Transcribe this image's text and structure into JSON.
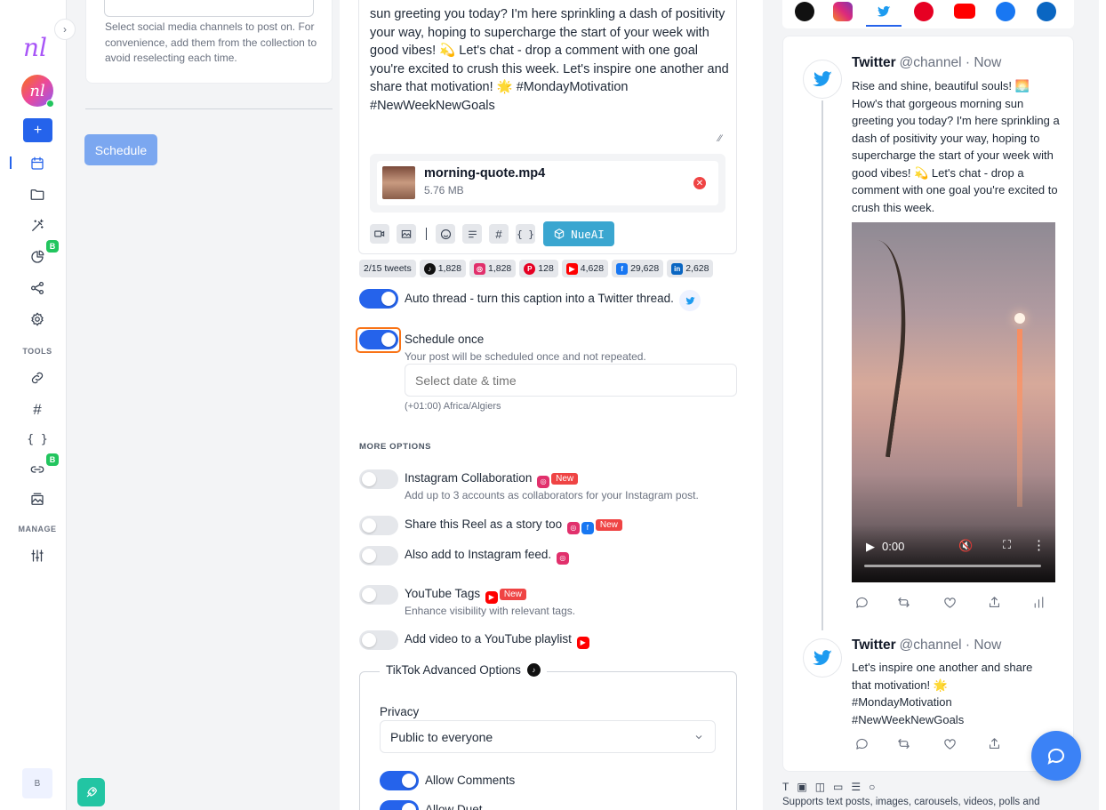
{
  "sidebar": {
    "logo_text": "nl",
    "avatar_text": "nl",
    "add_label": "+",
    "tools_label": "TOOLS",
    "manage_label": "MANAGE",
    "badge_b": "B",
    "bottom_user_initial": "B"
  },
  "left": {
    "channels_hint": "Select social media channels to post on. For convenience, add them from the collection to avoid reselecting each time.",
    "schedule_button": "Schedule"
  },
  "caption": {
    "lines": [
      "sun greeting you today? I'm here sprinkling a dash of positivity",
      "your way, hoping to supercharge the start of your week with",
      "good vibes! 💫 Let's chat - drop a comment with one goal",
      "you're excited to crush this week. Let's inspire one another and",
      "share that motivation! 🌟 #MondayMotivation",
      "#NewWeekNewGoals"
    ]
  },
  "media": {
    "file_name": "morning-quote.mp4",
    "file_size": "5.76 MB"
  },
  "toolbar": {
    "curly_label": "{ }",
    "hash_label": "#",
    "nueai_label": "NueAI"
  },
  "counts": {
    "tweets": "2/15 tweets",
    "tiktok": "1,828",
    "instagram": "1,828",
    "pinterest": "128",
    "youtube": "4,628",
    "facebook": "29,628",
    "linkedin": "2,628"
  },
  "auto_thread_label": "Auto thread - turn this caption into a Twitter thread.",
  "schedule_once": {
    "title": "Schedule once",
    "subtitle": "Your post will be scheduled once and not repeated.",
    "date_placeholder": "Select date & time",
    "timezone": "(+01:00) Africa/Algiers"
  },
  "more_options": {
    "heading": "MORE OPTIONS",
    "ig_collab_title": "Instagram Collaboration",
    "ig_collab_sub": "Add up to 3 accounts as collaborators for your Instagram post.",
    "reel_story_title": "Share this Reel as a story too",
    "ig_feed_title": "Also add to Instagram feed.",
    "yt_tags_title": "YouTube Tags",
    "yt_tags_sub": "Enhance visibility with relevant tags.",
    "yt_playlist_title": "Add video to a YouTube playlist",
    "new_tag": "New"
  },
  "tiktok": {
    "legend": "TikTok Advanced Options",
    "privacy_label": "Privacy",
    "privacy_value": "Public to everyone",
    "allow_comments": "Allow Comments",
    "allow_duet": "Allow Duet"
  },
  "preview": {
    "tweet1_name": "Twitter",
    "tweet1_handle": "@channel · Now",
    "tweet1_text": "Rise and shine, beautiful souls! 🌅 How's that gorgeous morning sun greeting you today? I'm here sprinkling a dash of positivity your way, hoping to supercharge the start of your week with good vibes! 💫 Let's chat - drop a comment with one goal you're excited to crush this week.",
    "video_time": "0:00",
    "tweet2_name": "Twitter",
    "tweet2_handle": "@channel · Now",
    "tweet2_text": "Let's inspire one another and share that motivation! 🌟 #MondayMotivation #NewWeekNewGoals",
    "supports_text": "Supports text posts, images, carousels, videos, polls and"
  },
  "colors": {
    "primary": "#2563eb",
    "twitter": "#1d9bf0",
    "nueai": "#3aa6d0",
    "focus_ring": "#f97316"
  }
}
